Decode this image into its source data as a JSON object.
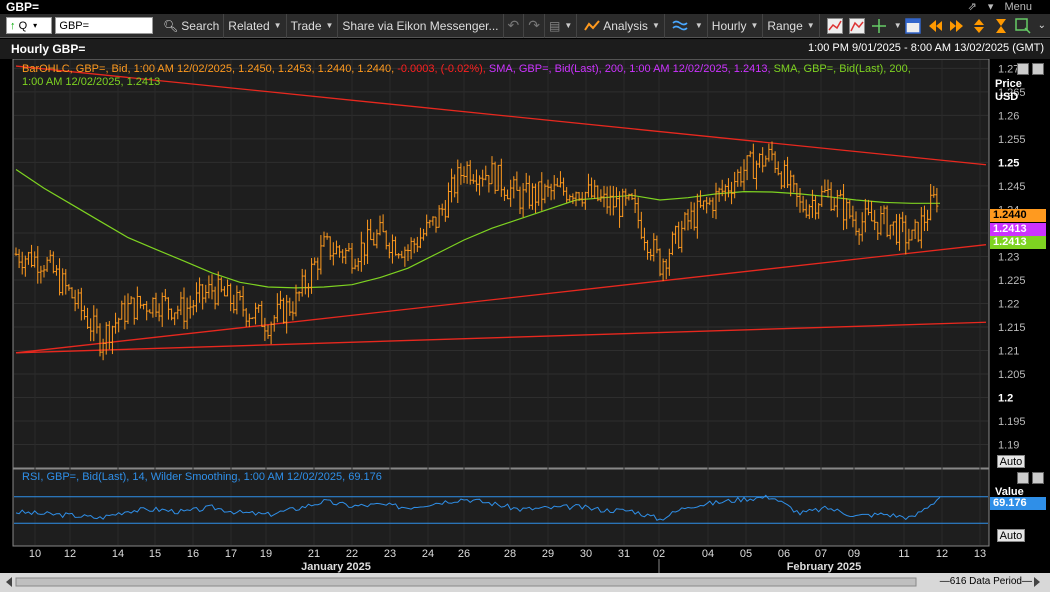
{
  "window": {
    "title": "GBP=",
    "menu_label": "Menu"
  },
  "toolbar": {
    "ric_value": "GBP=",
    "search": "Search",
    "related": "Related",
    "trade": "Trade",
    "share": "Share via Eikon Messenger...",
    "analysis": "Analysis",
    "interval": "Hourly",
    "range": "Range",
    "quote_prefix": "Q"
  },
  "chart_header": {
    "name": "Hourly GBP=",
    "range": "1:00 PM 9/01/2025 - 8:00 AM 13/02/2025 (GMT)"
  },
  "legend": {
    "bar_prefix": "BarOHLC, GBP=, Bid,  1:00 AM 12/02/2025, 1.2450,  1.2453,  1.2440,  1.2440,",
    "bar_change": "-0.0003,  (-0.02%),",
    "sma1": "SMA, GBP=, Bid(Last),  200,  1:00 AM 12/02/2025, 1.2413,",
    "sma2": "SMA, GBP=, Bid(Last),  200,",
    "sma2_line2": "1:00 AM 12/02/2025, 1.2413",
    "rsi": "RSI, GBP=, Bid(Last),  14,  Wilder Smoothing,  1:00 AM 12/02/2025, 69.176"
  },
  "price_axis": {
    "title_line1": "Price",
    "title_line2": "USD",
    "auto": "Auto",
    "last_price": "1.2440",
    "sma_magenta": "1.2413",
    "sma_green": "1.2413"
  },
  "rsi_axis": {
    "title": "Value",
    "last_value": "69.176",
    "auto": "Auto"
  },
  "status": {
    "data_period": "616 Data Period"
  },
  "colors": {
    "price": "#ff9a1f",
    "sma_green": "#7ed321",
    "sma_magenta": "#cc33ff",
    "trend": "#e8281e",
    "rsi": "#2f8fe8",
    "loss": "#ff2020"
  },
  "chart_data": [
    {
      "type": "line",
      "title": "",
      "ylabel": "Price USD",
      "ylim": [
        1.185,
        1.272
      ],
      "y_ticks": [
        1.19,
        1.195,
        1.2,
        1.205,
        1.21,
        1.215,
        1.22,
        1.225,
        1.23,
        1.235,
        1.24,
        1.245,
        1.25,
        1.255,
        1.26,
        1.265,
        1.27
      ],
      "y_ticks_bold": [
        1.2,
        1.25
      ],
      "x_ticks": [
        "10",
        "12",
        "14",
        "15",
        "16",
        "17",
        "19",
        "21",
        "22",
        "23",
        "24",
        "26",
        "28",
        "29",
        "30",
        "31",
        "02",
        "04",
        "05",
        "06",
        "07",
        "09",
        "11",
        "12",
        "13"
      ],
      "x_month_labels": [
        "January 2025",
        "February 2025"
      ],
      "grid": true,
      "series": [
        {
          "name": "BarOHLC GBP= Bid",
          "kind": "ohlc",
          "x": [
            "10",
            "11",
            "12",
            "13",
            "14",
            "15",
            "16",
            "17",
            "18",
            "19",
            "20",
            "21",
            "22",
            "23",
            "24",
            "25",
            "26",
            "27",
            "28",
            "29",
            "30",
            "31",
            "01",
            "02",
            "03",
            "04",
            "05",
            "06",
            "07",
            "08",
            "09",
            "10",
            "11",
            "12"
          ],
          "values": [
            1.2305,
            1.229,
            1.2215,
            1.2125,
            1.219,
            1.2205,
            1.2185,
            1.223,
            1.2195,
            1.216,
            1.2205,
            1.232,
            1.2305,
            1.2345,
            1.2315,
            1.2375,
            1.249,
            1.2475,
            1.2425,
            1.2435,
            1.2445,
            1.2415,
            1.2405,
            1.2285,
            1.2375,
            1.2425,
            1.2485,
            1.2515,
            1.2405,
            1.2435,
            1.2375,
            1.2375,
            1.2335,
            1.244
          ]
        },
        {
          "name": "SMA 200",
          "values": [
            1.2485,
            1.2445,
            1.241,
            1.2375,
            1.234,
            1.2315,
            1.229,
            1.2265,
            1.2245,
            1.2235,
            1.2233,
            1.2235,
            1.224,
            1.2255,
            1.2275,
            1.2305,
            1.2335,
            1.236,
            1.238,
            1.24,
            1.242,
            1.2425,
            1.243,
            1.242,
            1.2425,
            1.2433,
            1.2438,
            1.2437,
            1.2433,
            1.2427,
            1.242,
            1.2415,
            1.2413,
            1.2413
          ]
        },
        {
          "name": "Trend upper",
          "values_at_edges": [
            1.2705,
            1.2495
          ]
        },
        {
          "name": "Trend middle",
          "values_at_edges": [
            1.2095,
            1.2325
          ]
        },
        {
          "name": "Trend lower",
          "values_at_edges": [
            1.2095,
            1.216
          ]
        }
      ]
    },
    {
      "type": "line",
      "title": "",
      "ylabel": "Value",
      "series": [
        {
          "name": "RSI 14",
          "values": [
            47,
            44,
            42,
            38,
            49,
            51,
            47,
            54,
            46,
            43,
            52,
            63,
            56,
            58,
            54,
            61,
            67,
            60,
            51,
            53,
            55,
            50,
            49,
            36,
            56,
            61,
            67,
            70,
            45,
            53,
            41,
            44,
            38,
            69.176
          ]
        }
      ],
      "levels": [
        70,
        30
      ]
    }
  ]
}
